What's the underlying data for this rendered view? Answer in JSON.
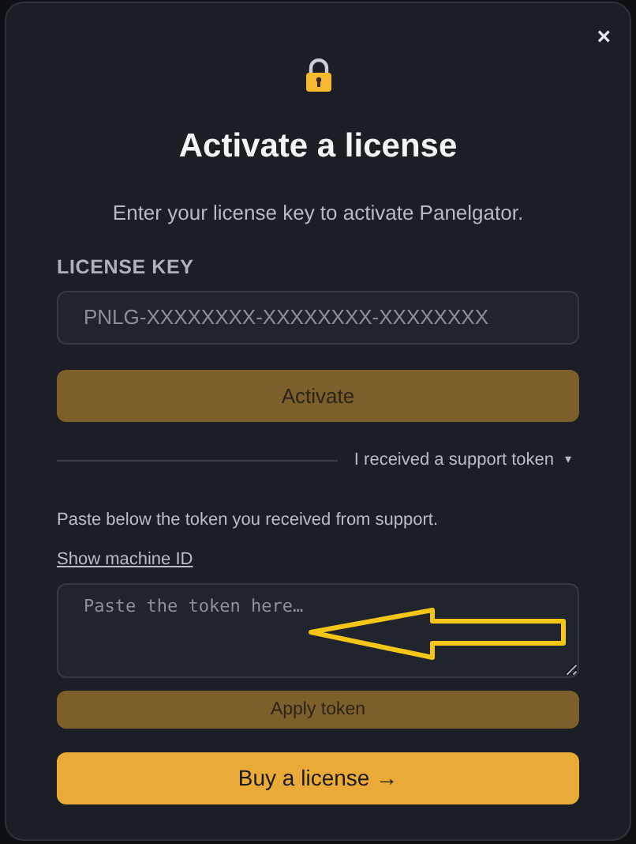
{
  "dialog": {
    "close": "×",
    "title": "Activate a license",
    "subtitle": "Enter your license key to activate Panelgator."
  },
  "license_field": {
    "label": "LICENSE KEY",
    "placeholder": "PNLG-XXXXXXXX-XXXXXXXX-XXXXXXXX"
  },
  "activate_button": {
    "label": "Activate",
    "disabled": true
  },
  "support_toggle": {
    "label": "I received a support token",
    "caret": "▾",
    "expanded": true
  },
  "support": {
    "instructions": "Paste below the token you received from support.",
    "machine_id_link": "Show machine ID",
    "placeholder": "Paste the token here…"
  },
  "apply_button": {
    "label": "Apply token",
    "disabled": true
  },
  "buy_button": {
    "label": "Buy a license →"
  }
}
